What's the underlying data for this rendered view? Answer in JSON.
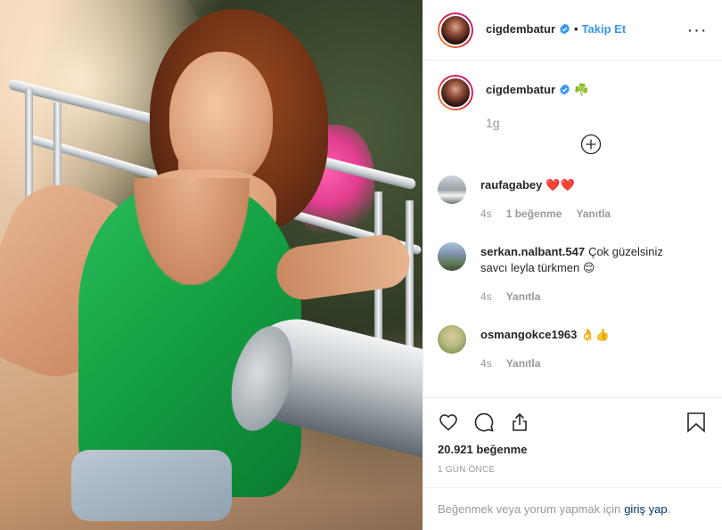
{
  "header": {
    "username": "cigdembatur",
    "separator": "•",
    "follow_label": "Takip Et",
    "more_label": "···"
  },
  "caption": {
    "username": "cigdembatur",
    "emoji": "☘️",
    "time": "1g"
  },
  "comments": [
    {
      "username": "raufagabey",
      "text": "❤️❤️",
      "time": "4s",
      "likes": "1 beğenme",
      "reply_label": "Yanıtla",
      "avatar_color": "#9aa3a8"
    },
    {
      "username": "serkan.nalbant.547",
      "text": "Çok güzelsiniz savcı leyla türkmen 😌",
      "time": "4s",
      "likes": "",
      "reply_label": "Yanıtla",
      "avatar_color": "#7a8fa3"
    },
    {
      "username": "osmangokce1963",
      "text": "👌👍",
      "time": "4s",
      "likes": "",
      "reply_label": "Yanıtla",
      "avatar_color": "#b3bb7e"
    }
  ],
  "actions": {
    "like_icon": "heart-icon",
    "comment_icon": "comment-icon",
    "share_icon": "share-icon",
    "save_icon": "bookmark-icon",
    "likes_count": "20.921 beğenme",
    "post_time": "1 GÜN ÖNCE"
  },
  "login_prompt": {
    "text": "Beğenmek veya yorum yapmak için",
    "link": "giriş yap",
    "suffix": "."
  },
  "colors": {
    "accent": "#3897f0",
    "text": "#262626",
    "muted": "#999999",
    "border": "#efefef",
    "heart": "#ed4956",
    "link": "#003569"
  }
}
